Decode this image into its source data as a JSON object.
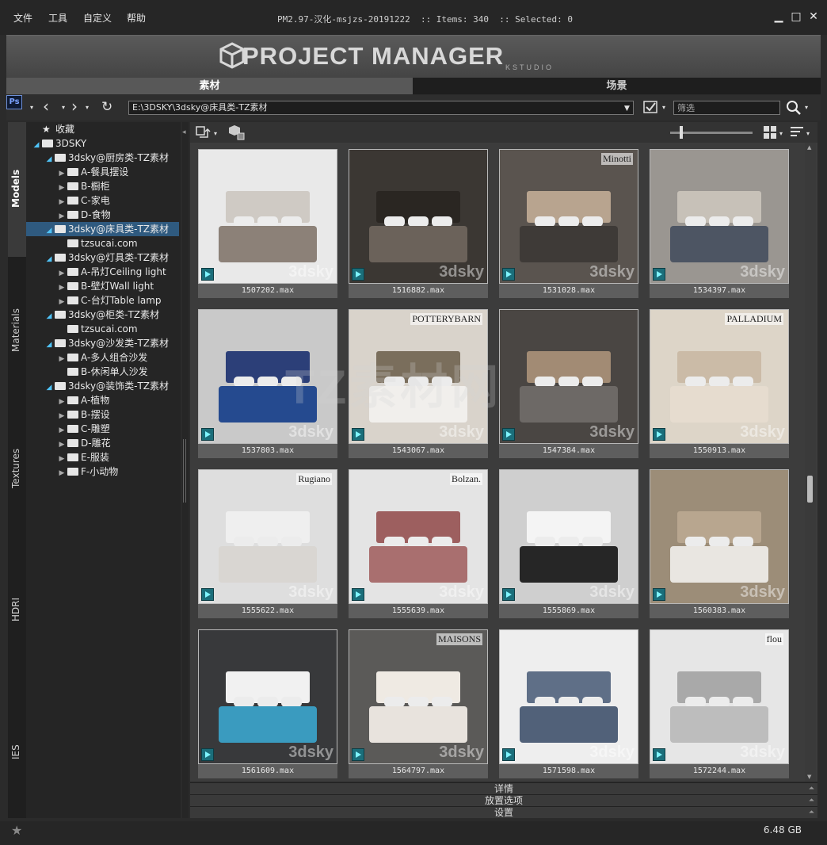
{
  "menu": [
    "文件",
    "工具",
    "自定义",
    "帮助"
  ],
  "window_title": "PM2.97-汉化-msjzs-20191222  :: Items: 340  :: Selected: 0",
  "window_controls": {
    "minimize": "▁",
    "maximize": "□",
    "close": "✕"
  },
  "banner": {
    "logo": "PROJECT MANAGER",
    "sub": "KSTUDIO"
  },
  "tabs": {
    "assets": "素材",
    "scene": "场景"
  },
  "toolbar": {
    "path": "E:\\3DSKY\\3dsky@床具类-TZ素材",
    "filter_placeholder": "筛选"
  },
  "side_tabs": [
    "Models",
    "Materials",
    "Textures",
    "HDRI",
    "IES"
  ],
  "tree": [
    {
      "label": "收藏",
      "level": 0,
      "arrow": "",
      "type": "favorites"
    },
    {
      "label": "3DSKY",
      "level": 0,
      "arrow": "open",
      "type": "folder"
    },
    {
      "label": "3dsky@厨房类-TZ素材",
      "level": 1,
      "arrow": "open",
      "type": "folder"
    },
    {
      "label": "A-餐具摆设",
      "level": 2,
      "arrow": "closed",
      "type": "folder"
    },
    {
      "label": "B-橱柜",
      "level": 2,
      "arrow": "closed",
      "type": "folder"
    },
    {
      "label": "C-家电",
      "level": 2,
      "arrow": "closed",
      "type": "folder"
    },
    {
      "label": "D-食物",
      "level": 2,
      "arrow": "closed",
      "type": "folder"
    },
    {
      "label": "3dsky@床具类-TZ素材",
      "level": 1,
      "arrow": "open",
      "type": "folder",
      "selected": true
    },
    {
      "label": "tzsucai.com",
      "level": 2,
      "arrow": "",
      "type": "folder"
    },
    {
      "label": "3dsky@灯具类-TZ素材",
      "level": 1,
      "arrow": "open",
      "type": "folder"
    },
    {
      "label": "A-吊灯Ceiling light",
      "level": 2,
      "arrow": "closed",
      "type": "folder"
    },
    {
      "label": "B-壁灯Wall light",
      "level": 2,
      "arrow": "closed",
      "type": "folder"
    },
    {
      "label": "C-台灯Table lamp",
      "level": 2,
      "arrow": "closed",
      "type": "folder"
    },
    {
      "label": "3dsky@柜类-TZ素材",
      "level": 1,
      "arrow": "open",
      "type": "folder"
    },
    {
      "label": "tzsucai.com",
      "level": 2,
      "arrow": "",
      "type": "folder"
    },
    {
      "label": "3dsky@沙发类-TZ素材",
      "level": 1,
      "arrow": "open",
      "type": "folder"
    },
    {
      "label": "A-多人组合沙发",
      "level": 2,
      "arrow": "closed",
      "type": "folder"
    },
    {
      "label": "B-休闲单人沙发",
      "level": 2,
      "arrow": "",
      "type": "folder"
    },
    {
      "label": "3dsky@装饰类-TZ素材",
      "level": 1,
      "arrow": "open",
      "type": "folder"
    },
    {
      "label": "A-植物",
      "level": 2,
      "arrow": "closed",
      "type": "folder"
    },
    {
      "label": "B-摆设",
      "level": 2,
      "arrow": "closed",
      "type": "folder"
    },
    {
      "label": "C-雕塑",
      "level": 2,
      "arrow": "closed",
      "type": "folder"
    },
    {
      "label": "D-雕花",
      "level": 2,
      "arrow": "closed",
      "type": "folder"
    },
    {
      "label": "E-服装",
      "level": 2,
      "arrow": "closed",
      "type": "folder"
    },
    {
      "label": "F-小动物",
      "level": 2,
      "arrow": "closed",
      "type": "folder"
    }
  ],
  "thumbnails": [
    {
      "file": "1507202.max",
      "bg": "#e9e9e9",
      "bed": "#8c8178",
      "head": "#cfcac4",
      "label": "",
      "wm": "3dsky"
    },
    {
      "file": "1516882.max",
      "bg": "#3b3733",
      "bed": "#6b625a",
      "head": "#2a2622",
      "label": "",
      "wm": "3dsky"
    },
    {
      "file": "1531028.max",
      "bg": "#5a544f",
      "bed": "#3e3a37",
      "head": "#b8a48f",
      "label": "Minotti",
      "wm": "3dsky"
    },
    {
      "file": "1534397.max",
      "bg": "#9a9691",
      "bed": "#4d5563",
      "head": "#c7c1b8",
      "label": "",
      "wm": "3dsky"
    },
    {
      "file": "1537803.max",
      "bg": "#c9c9c9",
      "bed": "#254a8f",
      "head": "#2c3f78",
      "label": "",
      "wm": "3dsky"
    },
    {
      "file": "1543067.max",
      "bg": "#d9d3cb",
      "bed": "#f1efec",
      "head": "#7a6e5c",
      "label": "POTTERYBARN",
      "wm": "3dsky"
    },
    {
      "file": "1547384.max",
      "bg": "#4a4643",
      "bed": "#6d6966",
      "head": "#a28b74",
      "label": "",
      "wm": "3dsky"
    },
    {
      "file": "1550913.max",
      "bg": "#ddd5c8",
      "bed": "#e6dccf",
      "head": "#cbbba7",
      "label": "PALLADIUM",
      "wm": "3dsky"
    },
    {
      "file": "1555622.max",
      "bg": "#dedede",
      "bed": "#d9d6d2",
      "head": "#efefef",
      "label": "Rugiano",
      "wm": "3dsky"
    },
    {
      "file": "1555639.max",
      "bg": "#e4e4e4",
      "bed": "#a96f6f",
      "head": "#9d5f5f",
      "label": "Bolzan.",
      "wm": "3dsky"
    },
    {
      "file": "1555869.max",
      "bg": "#cfcfcf",
      "bed": "#262626",
      "head": "#f4f4f4",
      "label": "",
      "wm": "3dsky"
    },
    {
      "file": "1560383.max",
      "bg": "#9c8d78",
      "bed": "#e9e6e1",
      "head": "#b8a68f",
      "label": "",
      "wm": "3dsky"
    },
    {
      "file": "1561609.max",
      "bg": "#38393b",
      "bed": "#3a9bbf",
      "head": "#f1f1f1",
      "label": "",
      "wm": "3dsky"
    },
    {
      "file": "1564797.max",
      "bg": "#5b5a58",
      "bed": "#e8e3dd",
      "head": "#efeae3",
      "label": "MAISONS",
      "wm": "3dsky"
    },
    {
      "file": "1571598.max",
      "bg": "#eeeeee",
      "bed": "#516179",
      "head": "#5f6f87",
      "label": "",
      "wm": "3dsky"
    },
    {
      "file": "1572244.max",
      "bg": "#e6e6e6",
      "bed": "#bdbdbd",
      "head": "#a9a9a9",
      "label": "flou",
      "wm": "3dsky"
    }
  ],
  "bottom_panels": [
    "详情",
    "放置选项",
    "设置"
  ],
  "status": {
    "disk": "6.48 GB"
  },
  "watermark": "TZ素材网"
}
